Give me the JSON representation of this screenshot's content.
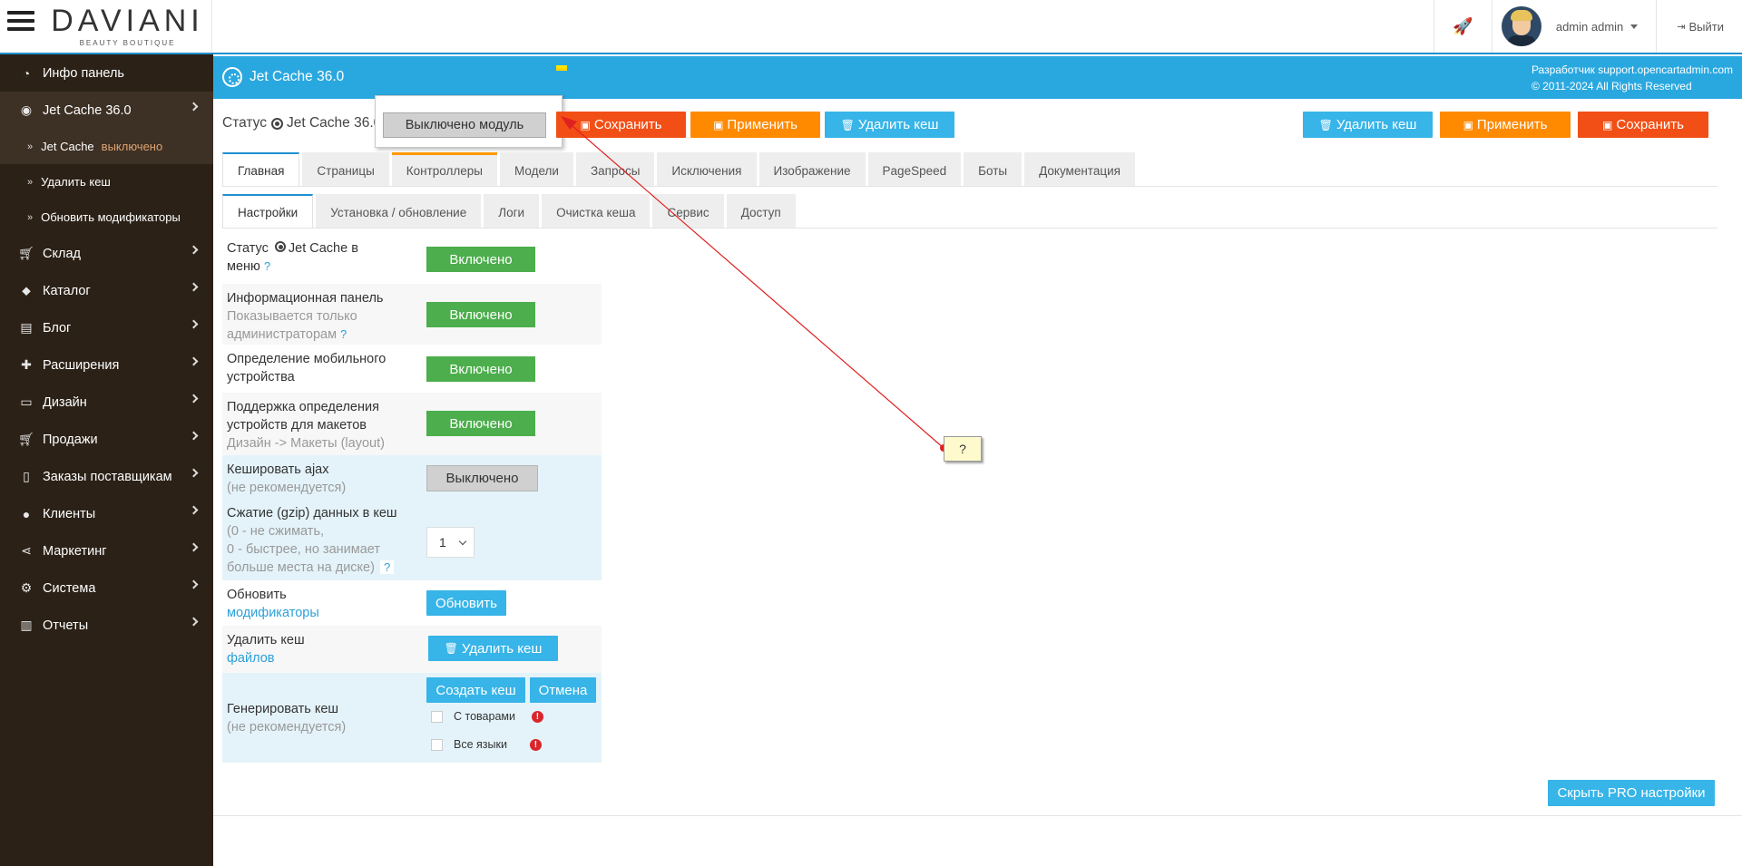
{
  "header": {
    "logo_main": "DAVIANI",
    "logo_sub": "BEAUTY BOUTIQUE",
    "user_name": "admin admin",
    "logout": "Выйти"
  },
  "sidebar": {
    "items": [
      {
        "label": "Инфо панель",
        "icon": "dashboard-icon"
      },
      {
        "label": "Jet Cache 36.0",
        "icon": "dot-circle-icon"
      },
      {
        "label": "Jet Cache",
        "status": "выключено"
      },
      {
        "label": "Удалить кеш"
      },
      {
        "label": "Обновить модификаторы"
      },
      {
        "label": "Склад",
        "icon": "cart-icon"
      },
      {
        "label": "Каталог",
        "icon": "tags-icon"
      },
      {
        "label": "Блог",
        "icon": "book-icon"
      },
      {
        "label": "Расширения",
        "icon": "puzzle-icon"
      },
      {
        "label": "Дизайн",
        "icon": "monitor-icon"
      },
      {
        "label": "Продажи",
        "icon": "shopping-cart-icon"
      },
      {
        "label": "Заказы поставщикам",
        "icon": "file-icon"
      },
      {
        "label": "Клиенты",
        "icon": "user-icon"
      },
      {
        "label": "Маркетинг",
        "icon": "share-icon"
      },
      {
        "label": "Система",
        "icon": "gear-icon"
      },
      {
        "label": "Отчеты",
        "icon": "bar-chart-icon"
      }
    ]
  },
  "titlebar": {
    "title": "Jet Cache 36.0",
    "credits_1": "Разработчик support.opencartadmin.com",
    "credits_2": "© 2011-2024 All Rights Reserved"
  },
  "toolbar": {
    "status_label": "Статус",
    "status_name": "Jet Cache 36.0",
    "module_off": "Выключено модуль",
    "save": "Сохранить",
    "apply": "Применить",
    "delete_cache": "Удалить кеш"
  },
  "tabs_main": [
    "Главная",
    "Страницы",
    "Контроллеры",
    "Модели",
    "Запросы",
    "Исключения",
    "Изображение",
    "PageSpeed",
    "Боты",
    "Документация"
  ],
  "tabs_sub": [
    "Настройки",
    "Установка / обновление",
    "Логи",
    "Очистка кеша",
    "Сервис",
    "Доступ"
  ],
  "settings": {
    "row1_a": "Статус",
    "row1_b": "Jet Cache в",
    "row1_c": "меню",
    "row2_a": "Информационная панель",
    "row2_b": "Показывается только",
    "row2_c": "администраторам",
    "row3_a": "Определение мобильного",
    "row3_b": "устройства",
    "row4_a": "Поддержка определения",
    "row4_b": "устройств для макетов",
    "row4_c": "Дизайн -> Макеты (layout)",
    "row5_a": "Кешировать ajax",
    "row5_b": "(не рекомендуется)",
    "row6_a": "Сжатие (gzip) данных в кеш",
    "row6_b": "(0 - не сжимать,",
    "row6_c": "0 - быстрее, но занимает",
    "row6_d": "больше места на диске)",
    "row7_a": "Обновить",
    "row7_b": "модификаторы",
    "row8_a": "Удалить кеш",
    "row8_b": "файлов",
    "row9_a": "Генерировать кеш",
    "row9_b": "(не рекомендуется)",
    "on": "Включено",
    "off": "Выключено",
    "gzip_value": "1",
    "update_btn": "Обновить",
    "delete_btn": "Удалить кеш",
    "create_btn": "Создать кеш",
    "cancel_btn": "Отмена",
    "cb_products": "С товарами",
    "cb_languages": "Все языки",
    "q": "?"
  },
  "hide_pro": "Скрыть PRO настройки",
  "annotation": {
    "text": "?",
    "color": "#e02020"
  }
}
